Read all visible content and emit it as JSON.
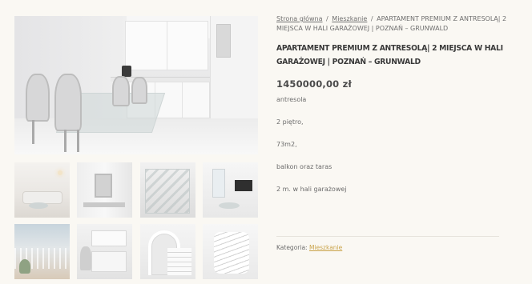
{
  "breadcrumb": {
    "home": "Strona główna",
    "separator": "/",
    "category": "Mieszkanie",
    "current": "APARTAMENT PREMIUM Z ANTRESOLĄ| 2 MIEJSCA W HALI GARAŻOWEJ | POZNAŃ – GRUNWALD"
  },
  "product": {
    "title": "APARTAMENT PREMIUM Z ANTRESOLĄ| 2 MIEJSCA W HALI GARAŻOWEJ | POZNAŃ – GRUNWALD",
    "price": "1450000,00 zł",
    "description": [
      "antresola",
      "2 piętro,",
      "73m2,",
      "balkon oraz taras",
      "2 m. w hali garażowej"
    ]
  },
  "meta": {
    "category_label": "Kategoria:",
    "category_value": "Mieszkanie"
  },
  "colors": {
    "background": "#faf8f3",
    "link_accent": "#c9a34a",
    "text": "#6a6a6a",
    "title": "#3a3a3a"
  }
}
